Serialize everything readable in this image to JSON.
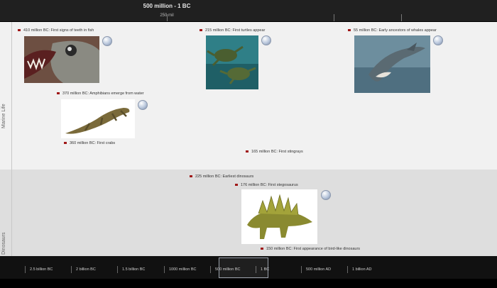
{
  "header": {
    "era_range": "500 million - 1 BC",
    "scale_label": "250 mil"
  },
  "bands": {
    "marine": {
      "label": "Marine Life"
    },
    "dino": {
      "label": "Dinosaurs"
    }
  },
  "events": {
    "teeth": "410 million BC: First signs of teeth in fish",
    "turtles": "215 million BC: First turtles appear",
    "whales": "55 million BC: Early ancestors of whales appear",
    "amphibians": "370 million BC: Amphibians emerge from water",
    "crabs": "360 million BC: First crabs",
    "stingrays": "165 million BC: First stingrays",
    "earliest_dino": "225 million BC: Earliest dinosaurs",
    "stegosaurus": "176 million BC: First stegosaurus",
    "birds": "150 million BC: First appearance of bird-like dinosaurs"
  },
  "navigator": {
    "ticks": [
      "2.5 billion BC",
      "2 billion BC",
      "1.5 billion BC",
      "1000 million BC",
      "500 million BC",
      "1 BC",
      "500 million AD",
      "1 billion AD"
    ]
  },
  "colors": {
    "event_marker": "#a01818",
    "header_bg": "#202020",
    "marine_band": "#f1f1f1",
    "dino_band": "#dedede"
  }
}
